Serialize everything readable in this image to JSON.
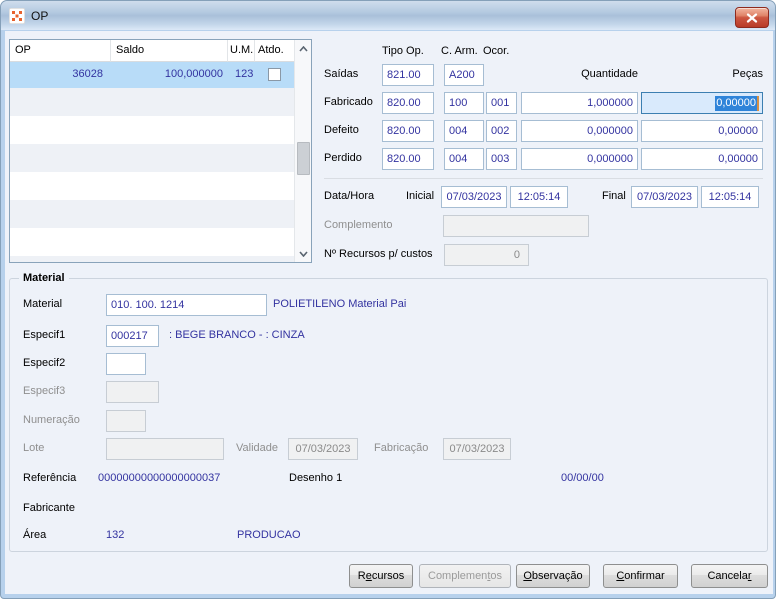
{
  "window": {
    "title": "OP"
  },
  "icons": {
    "app": "app-icon",
    "close": "close-icon",
    "scroll_up": "scroll-up-icon",
    "scroll_down": "scroll-down-icon",
    "checkbox": "checkbox-unchecked"
  },
  "colors": {
    "field_text": "#3333a0",
    "selection_bg": "#2f84d9",
    "focus_border": "#3c7fb1",
    "row_selected": "#b8dcf8",
    "close_button": "#cd5741"
  },
  "grid": {
    "headers": {
      "op": "OP",
      "saldo": "Saldo",
      "um": "U.M.",
      "atdo": "Atdo."
    },
    "selected_row": {
      "op": "36028",
      "saldo": "100,000000",
      "um": "123",
      "atdo_checked": false
    }
  },
  "operations": {
    "headers": {
      "tipo_op": "Tipo Op.",
      "c_arm": "C. Arm.",
      "ocor": "Ocor.",
      "quantidade": "Quantidade",
      "pecas": "Peças"
    },
    "saidas": {
      "label": "Saídas",
      "tipo_op": "821.00",
      "c_arm": "A200"
    },
    "fabricado": {
      "label": "Fabricado",
      "tipo_op": "820.00",
      "c_arm": "100",
      "ocor": "001",
      "quantidade": "1,000000",
      "pecas": "0,00000"
    },
    "defeito": {
      "label": "Defeito",
      "tipo_op": "820.00",
      "c_arm": "004",
      "ocor": "002",
      "quantidade": "0,000000",
      "pecas": "0,00000"
    },
    "perdido": {
      "label": "Perdido",
      "tipo_op": "820.00",
      "c_arm": "004",
      "ocor": "003",
      "quantidade": "0,000000",
      "pecas": "0,00000"
    }
  },
  "datahora": {
    "label": "Data/Hora",
    "inicial_label": "Inicial",
    "inicial_date": "07/03/2023",
    "inicial_time": "12:05:14",
    "final_label": "Final",
    "final_date": "07/03/2023",
    "final_time": "12:05:14"
  },
  "complemento": {
    "label": "Complemento",
    "value": ""
  },
  "recursos_custos": {
    "label": "Nº Recursos p/ custos",
    "value": "0"
  },
  "material": {
    "group_title": "Material",
    "material_label": "Material",
    "material_value": "010. 100. 1214",
    "material_desc": "POLIETILENO Material Pai",
    "especif1_label": "Especif1",
    "especif1_value": "000217",
    "especif1_desc": ": BEGE BRANCO - : CINZA",
    "especif2_label": "Especif2",
    "especif2_value": "",
    "especif3_label": "Especif3",
    "especif3_value": "",
    "numeracao_label": "Numeração",
    "numeracao_value": "",
    "lote_label": "Lote",
    "lote_value": "",
    "validade_label": "Validade",
    "validade_value": "07/03/2023",
    "fabricacao_label": "Fabricação",
    "fabricacao_value": "07/03/2023",
    "referencia_label": "Referência",
    "referencia_value": "00000000000000000037",
    "desenho": "Desenho 1",
    "referencia_data": "00/00/00",
    "fabricante_label": "Fabricante",
    "fabricante_value": "",
    "area_label": "Área",
    "area_value": "132",
    "area_desc": "PRODUCAO"
  },
  "buttons": {
    "recursos": {
      "pre": "R",
      "key": "e",
      "post": "cursos"
    },
    "complementos": {
      "pre": "Complemen",
      "key": "t",
      "post": "os"
    },
    "observacao": {
      "pre": "",
      "key": "O",
      "post": "bservação"
    },
    "confirmar": {
      "pre": "",
      "key": "C",
      "post": "onfirmar"
    },
    "cancelar": {
      "pre": "Cancela",
      "key": "r",
      "post": ""
    }
  }
}
